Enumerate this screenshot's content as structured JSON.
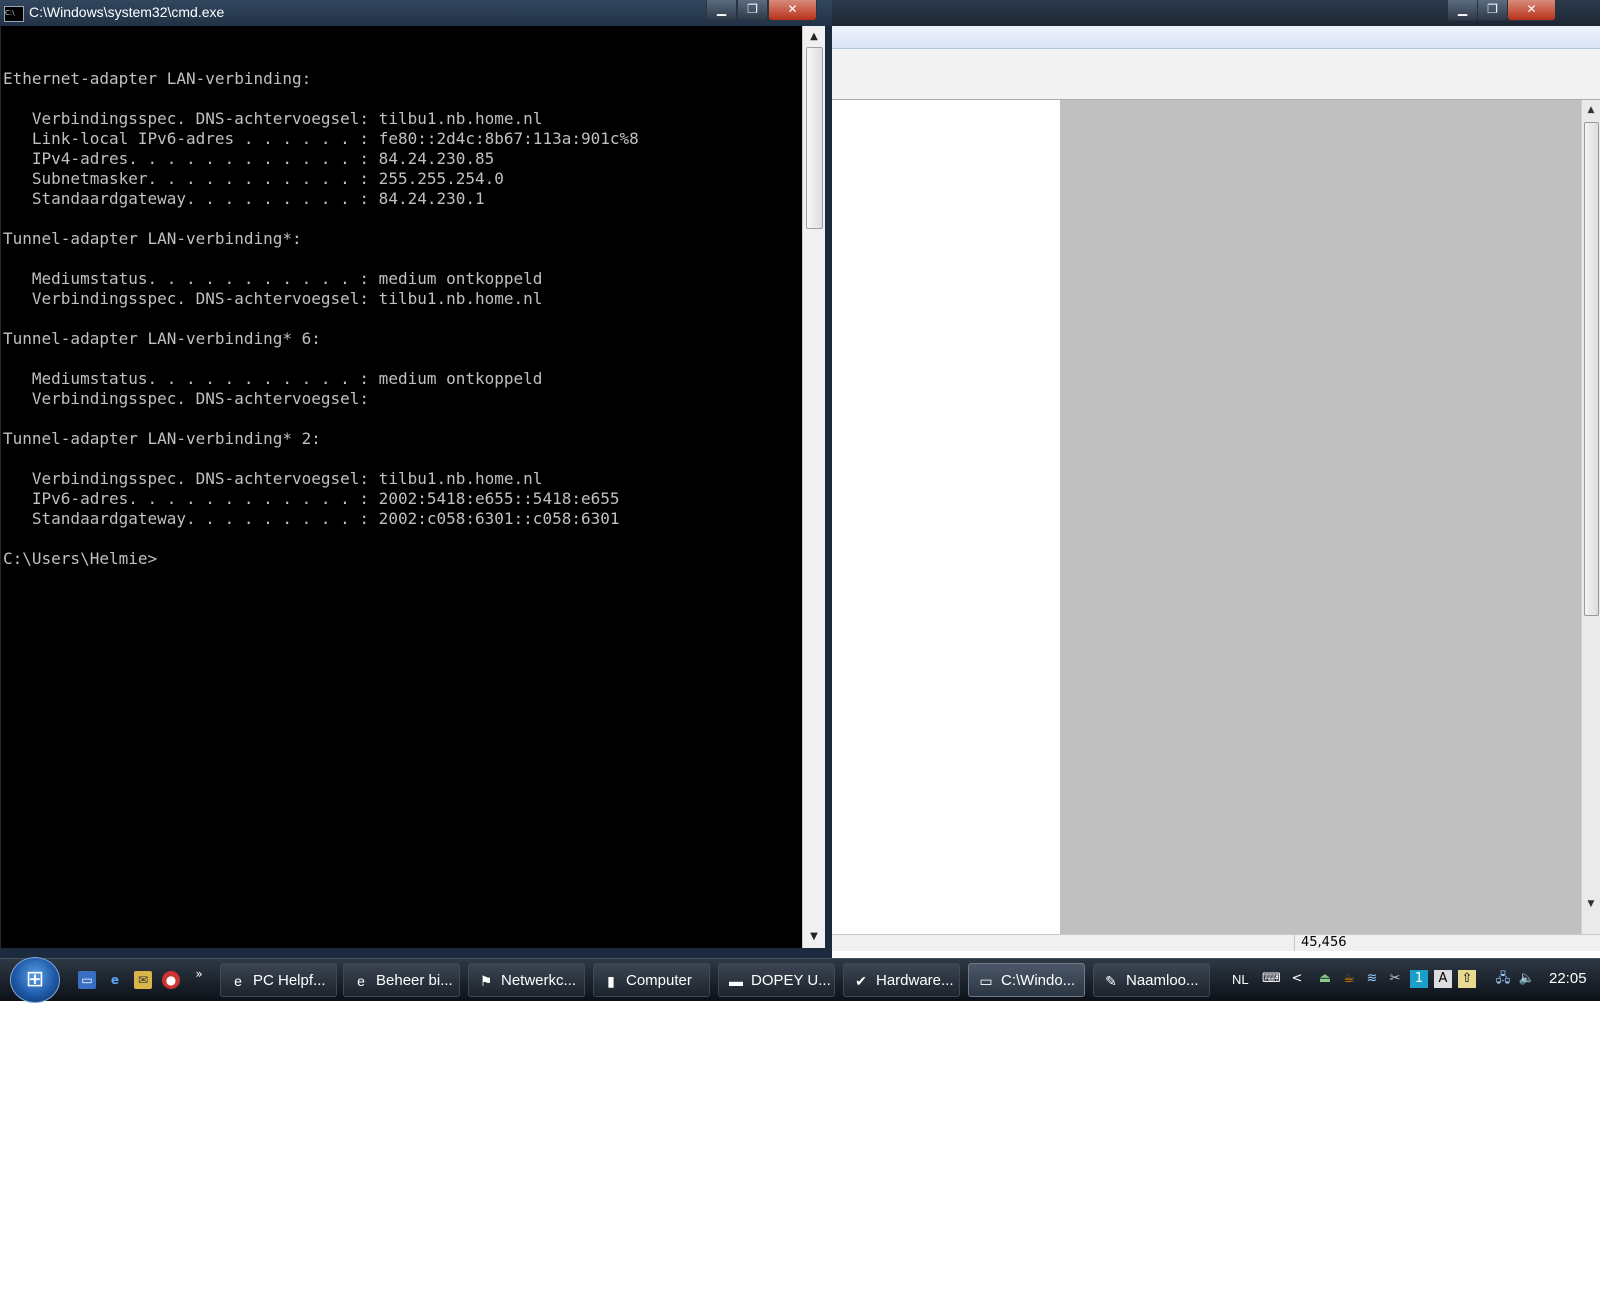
{
  "cmd": {
    "title": "C:\\Windows\\system32\\cmd.exe",
    "lines": [
      "",
      "Ethernet-adapter LAN-verbinding:",
      "",
      "   Verbindingsspec. DNS-achtervoegsel: tilbu1.nb.home.nl",
      "   Link-local IPv6-adres . . . . . . : fe80::2d4c:8b67:113a:901c%8",
      "   IPv4-adres. . . . . . . . . . . . : 84.24.230.85",
      "   Subnetmasker. . . . . . . . . . . : 255.255.254.0",
      "   Standaardgateway. . . . . . . . . : 84.24.230.1",
      "",
      "Tunnel-adapter LAN-verbinding*:",
      "",
      "   Mediumstatus. . . . . . . . . . . : medium ontkoppeld",
      "   Verbindingsspec. DNS-achtervoegsel: tilbu1.nb.home.nl",
      "",
      "Tunnel-adapter LAN-verbinding* 6:",
      "",
      "   Mediumstatus. . . . . . . . . . . : medium ontkoppeld",
      "   Verbindingsspec. DNS-achtervoegsel:",
      "",
      "Tunnel-adapter LAN-verbinding* 2:",
      "",
      "   Verbindingsspec. DNS-achtervoegsel: tilbu1.nb.home.nl",
      "   IPv6-adres. . . . . . . . . . . . : 2002:5418:e655::5418:e655",
      "   Standaardgateway. . . . . . . . . : 2002:c058:6301::c058:6301",
      "",
      "C:\\Users\\Helmie>"
    ],
    "caption_minimize": "▁",
    "caption_restore": "❐",
    "caption_close": "✕",
    "scroll_up": "▲",
    "scroll_down": "▼"
  },
  "paint": {
    "status_coords": "45,456",
    "caption_minimize": "▁",
    "caption_restore": "❐",
    "caption_close": "✕",
    "scroll_up": "▲",
    "scroll_down": "▼"
  },
  "taskbar": {
    "start_icon": "windows-logo-icon",
    "start_glyph": "⊞",
    "quicklaunch_more": "»",
    "buttons": [
      {
        "label": "PC Helpf...",
        "icon": "internet-explorer-icon",
        "glyph": "e"
      },
      {
        "label": "Beheer bi...",
        "icon": "internet-explorer-icon",
        "glyph": "e"
      },
      {
        "label": "Netwerkc...",
        "icon": "network-icon",
        "glyph": "⚑"
      },
      {
        "label": "Computer",
        "icon": "folder-icon",
        "glyph": "▮"
      },
      {
        "label": "DOPEY U...",
        "icon": "drive-icon",
        "glyph": "▬"
      },
      {
        "label": "Hardware...",
        "icon": "hardware-icon",
        "glyph": "✔"
      },
      {
        "label": "C:\\Windo...",
        "icon": "cmd-icon",
        "glyph": "▭"
      },
      {
        "label": "Naamloo...",
        "icon": "paint-icon",
        "glyph": "✎"
      }
    ],
    "tray": {
      "language": "NL",
      "clock": "22:05",
      "chevron": "<"
    }
  },
  "colors": {
    "console_bg": "#000000",
    "console_text": "#c0c0c0",
    "canvas_gray": "#c0c0c0",
    "taskbar": "#1c232c"
  }
}
